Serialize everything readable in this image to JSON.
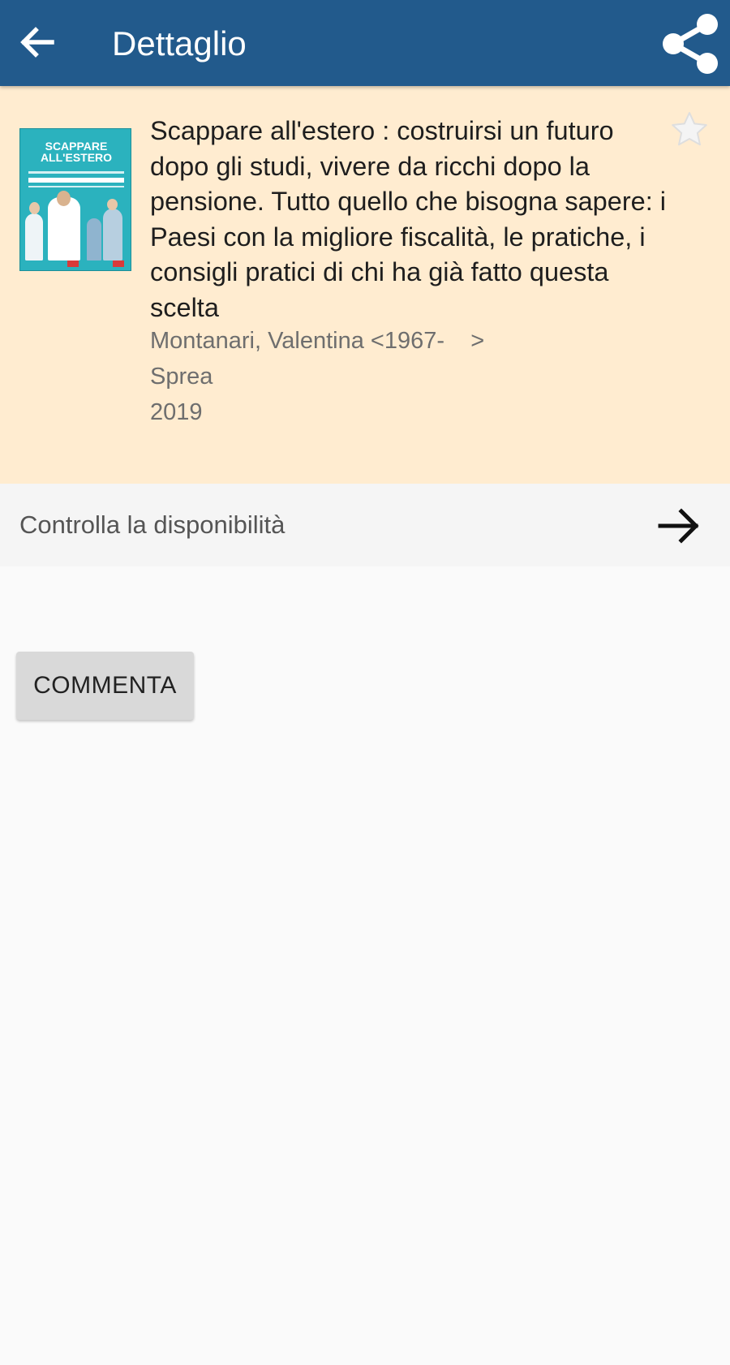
{
  "colors": {
    "appbar": "#225a8c",
    "detail_background": "#ffecd0",
    "availability_background": "#f5f5f5",
    "page_background": "#fafafa",
    "button_background": "#d9d9d9"
  },
  "header": {
    "back_icon": "arrow-back-icon",
    "title": "Dettaglio",
    "share_icon": "share-icon"
  },
  "book": {
    "cover_title": "SCAPPARE\nALL'ESTERO",
    "title": "Scappare all'estero : costruirsi un futuro dopo gli studi, vivere da ricchi dopo la pensione. Tutto quello che bisogna sapere: i Paesi con la migliore fiscalità, le pratiche, i consigli pratici di chi ha già fatto questa scelta",
    "author": "Montanari, Valentina <1967-    >",
    "publisher": "Sprea",
    "year": "2019",
    "favorite_icon": "star-outline-icon"
  },
  "availability": {
    "label": "Controlla la disponibilità",
    "icon": "arrow-forward-icon"
  },
  "actions": {
    "comment_label": "COMMENTA"
  }
}
